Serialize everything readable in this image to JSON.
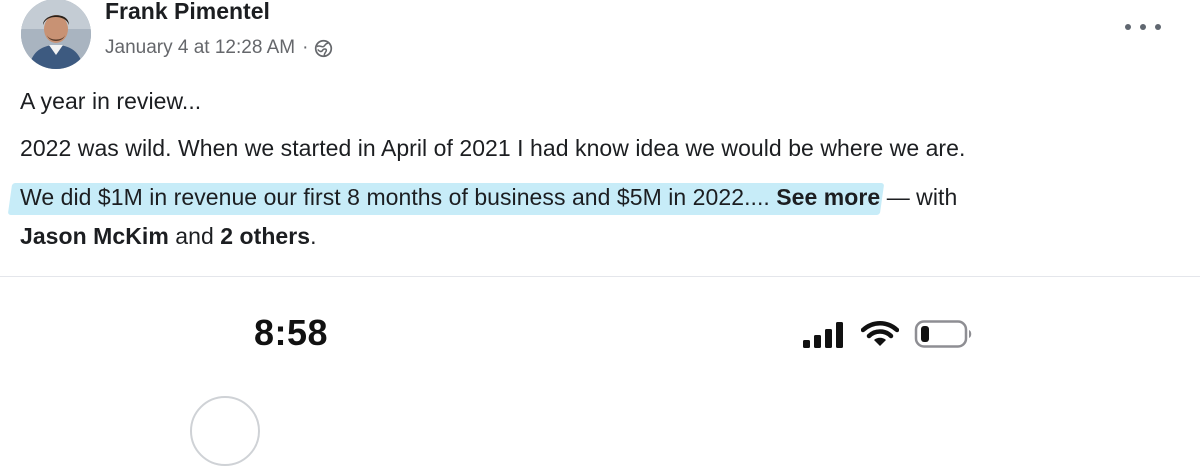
{
  "post": {
    "author": "Frank Pimentel",
    "timestamp": "January 4 at 12:28 AM",
    "separator": "·",
    "privacy_icon": "globe-icon",
    "more_icon": "more-options-icon",
    "text": {
      "line1": "A year in review...",
      "line2": "2022 was wild.  When we started in April of 2021 I had know idea we would be where we are.",
      "line3_highlighted": "We did $1M in revenue our first 8 months of business and $5M in 2022",
      "line3_ellipsis": "....",
      "see_more": "See more",
      "with_text": " — with",
      "tagged_person": "Jason McKim",
      "and_text": " and ",
      "others": "2 others",
      "end": "."
    },
    "highlight_color": "#c7ecf8"
  },
  "phone_status_bar": {
    "time": "8:58",
    "signal_icon": "signal-bars-icon",
    "wifi_icon": "wifi-icon",
    "battery_icon": "battery-icon"
  }
}
